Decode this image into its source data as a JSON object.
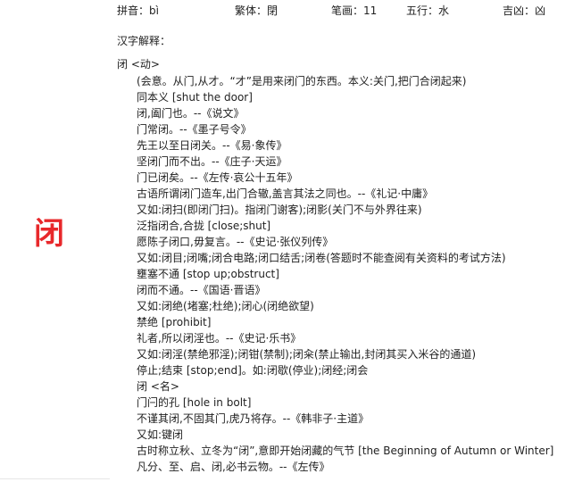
{
  "character": "闭",
  "info": {
    "pinyin": "拼音：bì",
    "traditional": "繁体：閉",
    "strokes": "笔画：11",
    "element": "五行：水",
    "fortune": "吉凶：凶"
  },
  "section_title": "汉字解释：",
  "entry_head": "闭 <动>",
  "lines": [
    "(会意。从门,从才。“才”是用来闭门的东西。本义:关门,把门合闭起来)",
    "同本义 [shut the door]",
    "闭,阖门也。--《说文》",
    "门常闭。--《墨子号令》",
    "先王以至日闭关。--《易·象传》",
    "坚闭门而不出。--《庄子·天运》",
    "门已闭矣。--《左传·哀公十五年》",
    "古语所谓闭门造车,出门合辙,盖言其法之同也。--《礼记·中庸》",
    "又如:闭扫(即闭门扫)。指闭门谢客);闭影(关门不与外界往来)",
    "泛指闭合,合拢 [close;shut]",
    "愿陈子闭口,毋复言。--《史记·张仪列传》",
    "又如:闭目;闭嘴;闭合电路;闭口结舌;闭卷(答题时不能查阅有关资料的考试方法)",
    "壅塞不通 [stop up;obstruct]",
    "闭而不通。--《国语·晋语》",
    "又如:闭绝(堵塞;杜绝);闭心(闭绝欲望)",
    "禁绝 [prohibit]",
    "礼者,所以闭淫也。--《史记·乐书》",
    "又如:闭淫(禁绝邪淫);闭钳(禁制);闭籴(禁止输出,封闭其买入米谷的通道)",
    "停止;结束 [stop;end]。如:闭歇(停业);闭经;闭会",
    "闭 <名>",
    "门闩的孔 [hole in bolt]",
    "不谨其闭,不固其门,虎乃将存。--《韩非子·主道》",
    "又如:键闭",
    "古时称立秋、立冬为“闭”,意即开始闭藏的气节 [the Beginning of Autumn or Winter]",
    "凡分、至、启、闭,必书云物。--《左传》"
  ],
  "colors": {
    "accent": "#e8282b",
    "text": "#222222"
  }
}
